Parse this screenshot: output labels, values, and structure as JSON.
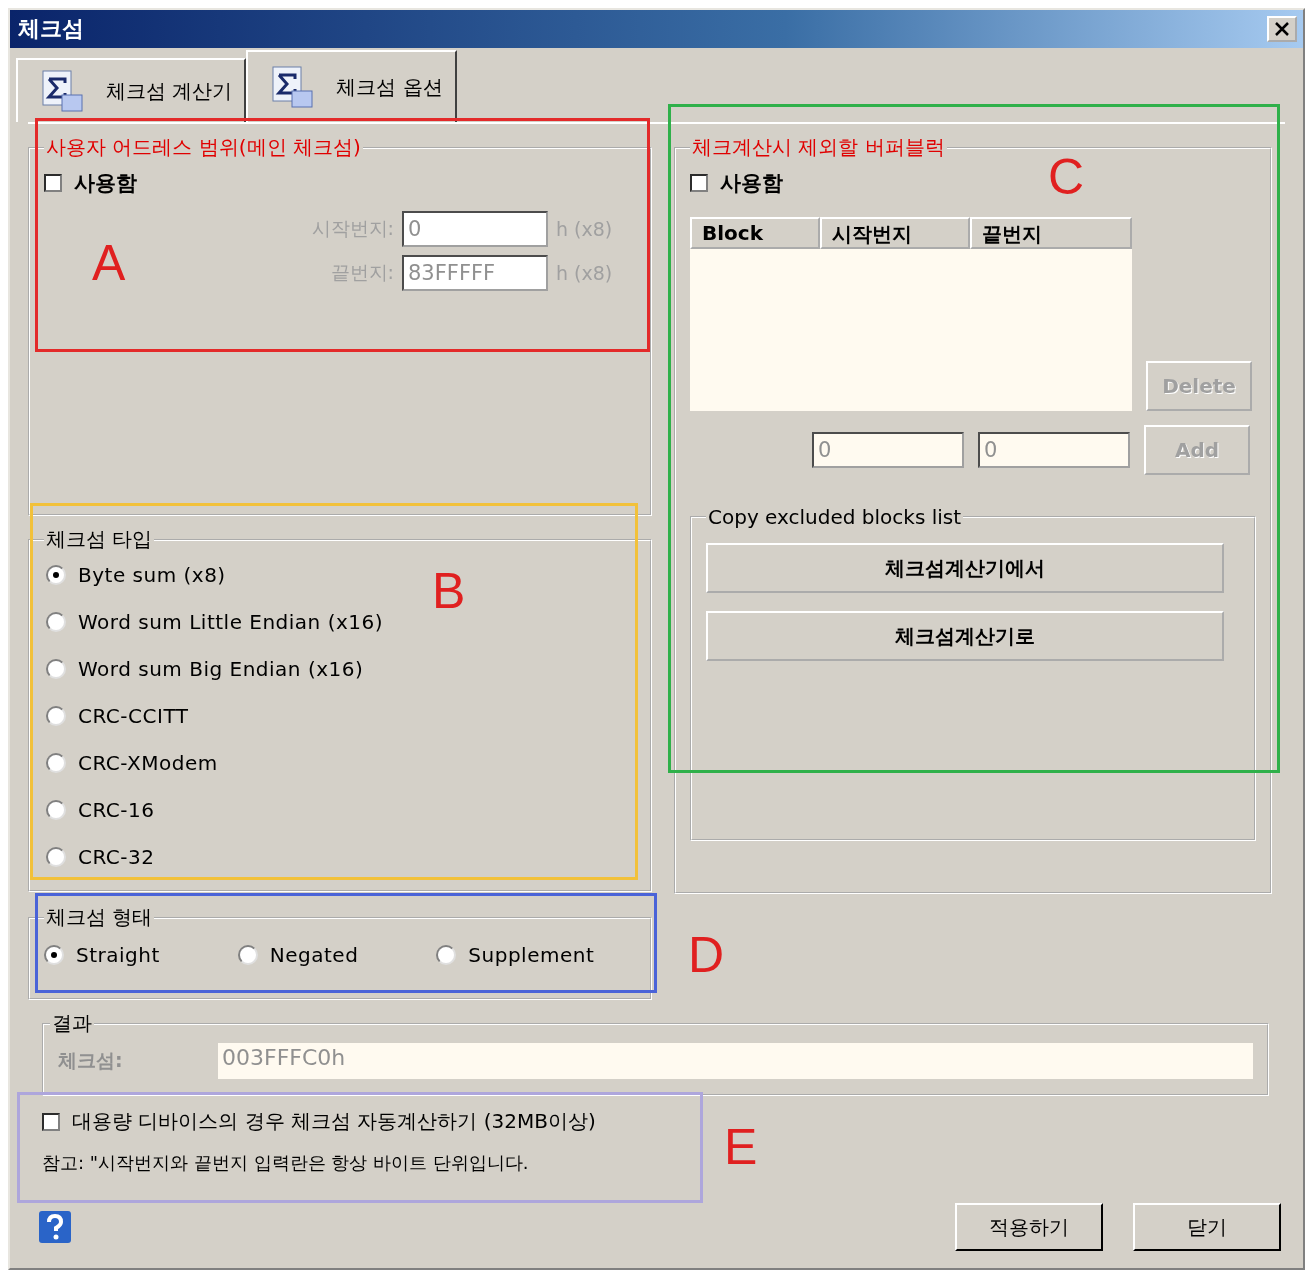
{
  "window": {
    "title": "체크섬"
  },
  "tabs": [
    {
      "label": "체크섬 계산기",
      "selected": false
    },
    {
      "label": "체크섬 옵션",
      "selected": true
    }
  ],
  "address_range": {
    "title": "사용자 어드레스 범위(메인 체크섬)",
    "enable": {
      "label": "사용함",
      "checked": false
    },
    "fields": [
      {
        "label": "시작번지:",
        "value": "0",
        "unit": "h (x8)",
        "disabled": true
      },
      {
        "label": "끝번지:",
        "value": "83FFFFF",
        "unit": "h (x8)",
        "disabled": true
      }
    ]
  },
  "checksum_type": {
    "title": "체크섬 타입",
    "options": [
      {
        "label": "Byte sum (x8)",
        "selected": true
      },
      {
        "label": "Word sum Little Endian (x16)",
        "selected": false
      },
      {
        "label": "Word sum Big Endian (x16)",
        "selected": false
      },
      {
        "label": "CRC-CCITT",
        "selected": false
      },
      {
        "label": "CRC-XModem",
        "selected": false
      },
      {
        "label": "CRC-16",
        "selected": false
      },
      {
        "label": "CRC-32",
        "selected": false
      }
    ]
  },
  "checksum_form": {
    "title": "체크섬 형태",
    "options": [
      {
        "label": "Straight",
        "selected": true
      },
      {
        "label": "Negated",
        "selected": false
      },
      {
        "label": "Supplement",
        "selected": false
      }
    ]
  },
  "excluded_blocks": {
    "title": "체크계산시 제외할 버퍼블럭",
    "enable": {
      "label": "사용함",
      "checked": false
    },
    "columns": [
      "Block",
      "시작번지",
      "끝번지"
    ],
    "start_value": "0",
    "end_value": "0",
    "delete_button": {
      "label": "Delete",
      "disabled": true
    },
    "add_button": {
      "label": "Add",
      "disabled": true
    },
    "copy": {
      "title": "Copy excluded blocks list",
      "buttons": [
        "체크섬계산기에서",
        "체크섬계산기로"
      ]
    }
  },
  "result": {
    "title": "결과",
    "label": "체크섬:",
    "value": "003FFFC0h"
  },
  "auto_calc": {
    "label": "대용량 디바이스의 경우 체크섬 자동계산하기 (32MB이상)",
    "checked": false
  },
  "note": "참고: \"시작번지와 끝번지 입력란은 항상 바이트 단위입니다.",
  "buttons": [
    "적용하기",
    "닫기"
  ],
  "annotations": [
    {
      "letter": "A",
      "color": "#e32a2a"
    },
    {
      "letter": "B",
      "color": "#f2c13a"
    },
    {
      "letter": "C",
      "color": "#2fb04a"
    },
    {
      "letter": "D",
      "color": "#4a63d8"
    },
    {
      "letter": "E",
      "color": "#aea6dc"
    }
  ]
}
